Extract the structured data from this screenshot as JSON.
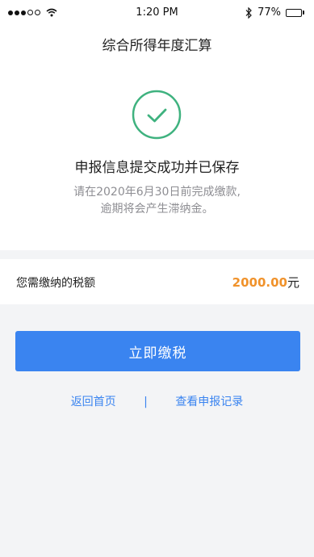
{
  "status_bar": {
    "time": "1:20 PM",
    "battery_text": "77%",
    "battery_level": 0.77,
    "signal_bars_filled": 3,
    "signal_bars_total": 5
  },
  "header": {
    "title": "综合所得年度汇算"
  },
  "result": {
    "icon": "check-circle-icon",
    "title": "申报信息提交成功并已保存",
    "notice_line1": "请在2020年6月30日前完成缴款,",
    "notice_line2": "逾期将会产生滞纳金。"
  },
  "tax": {
    "label": "您需缴纳的税额",
    "amount": "2000.00",
    "unit": "元"
  },
  "actions": {
    "pay_label": "立即缴税",
    "home_link": "返回首页",
    "separator": "|",
    "records_link": "查看申报记录"
  },
  "colors": {
    "accent": "#3a84f0",
    "success": "#3fb27f",
    "amount": "#f0922b",
    "background": "#f3f4f6"
  }
}
